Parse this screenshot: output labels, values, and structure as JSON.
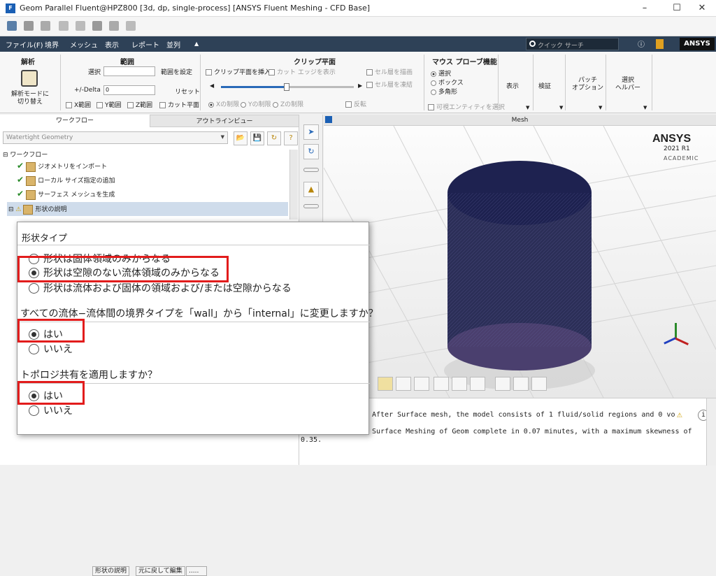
{
  "window": {
    "title": "Geom Parallel Fluent@HPZ800  [3d, dp, single-process] [ANSYS Fluent Meshing - CFD Base]",
    "app_icon": "F"
  },
  "menu": {
    "items": [
      "ファイル(F)",
      "境界",
      "メッシュ",
      "表示",
      "レポート",
      "並列"
    ],
    "search_placeholder": "クイック サーチ",
    "logo": "ANSYS"
  },
  "ribbon": {
    "analysis": {
      "title": "解析",
      "switch_label": "解析モードに\n切り替え"
    },
    "range": {
      "title": "範囲",
      "select_label": "選択",
      "set_range": "範囲を設定",
      "delta_label": "+/-Delta",
      "delta_value": "0",
      "reset": "リセット",
      "x_range": "X範囲",
      "y_range": "Y範囲",
      "z_range": "Z範囲",
      "cut_plane": "カット平面"
    },
    "clip": {
      "title": "クリップ平面",
      "insert": "クリップ平面を挿入",
      "cut_edge": "カット エッジを表示",
      "cell_draw": "セル層を描画",
      "cell_freeze": "セル層を凍結",
      "x_clip": "Xの制限",
      "y_clip": "Yの制限",
      "z_clip": "Zの制限",
      "invert": "反転"
    },
    "probe": {
      "title": "マウス プローブ機能",
      "select": "選択",
      "box": "ボックス",
      "polygon": "多角形",
      "visible_entity": "可視エンティティを選択"
    },
    "groups": [
      "表示",
      "検証",
      "パッチ\nオプション",
      "選択\nヘルパー"
    ]
  },
  "left_panel": {
    "tabs": [
      "ワークフロー",
      "アウトラインビュー"
    ],
    "workflow_select": "Watertight Geometry",
    "tree_root": "ワークフロー",
    "tree_items": [
      "ジオメトリをインポート",
      "ローカル サイズ指定の追加",
      "サーフェス メッシュを生成",
      "形状の説明"
    ],
    "bottom_buttons": [
      "形状の説明",
      "元に戻して編集",
      "....."
    ]
  },
  "graphics": {
    "title": "Mesh",
    "brand": "ANSYS",
    "version": "2021 R1",
    "edition": "ACADEMIC"
  },
  "console": {
    "lines": [
      "After Surface mesh, the model consists of 1 fluid/solid regions and 0 vo",
      "Surface Meshing of Geom complete in  0.07 minutes, with a maximum skewness of",
      "0.35."
    ]
  },
  "popup": {
    "geometry_type_label": "形状タイプ",
    "geometry_options": [
      "形状は固体領域のみからなる",
      "形状は空隙のない流体領域のみからなる",
      "形状は流体および固体の領域および/または空隙からなる"
    ],
    "wall_question": "すべての流体−流体間の境界タイプを「wall」から「internal」に変更しますか？",
    "topology_question": "トポロジ共有を適用しますか？",
    "yes": "はい",
    "no": "いいえ"
  },
  "colors": {
    "menubar": "#2e4157",
    "highlight": "#e21c1c",
    "mesh": "#2a2e5a"
  }
}
